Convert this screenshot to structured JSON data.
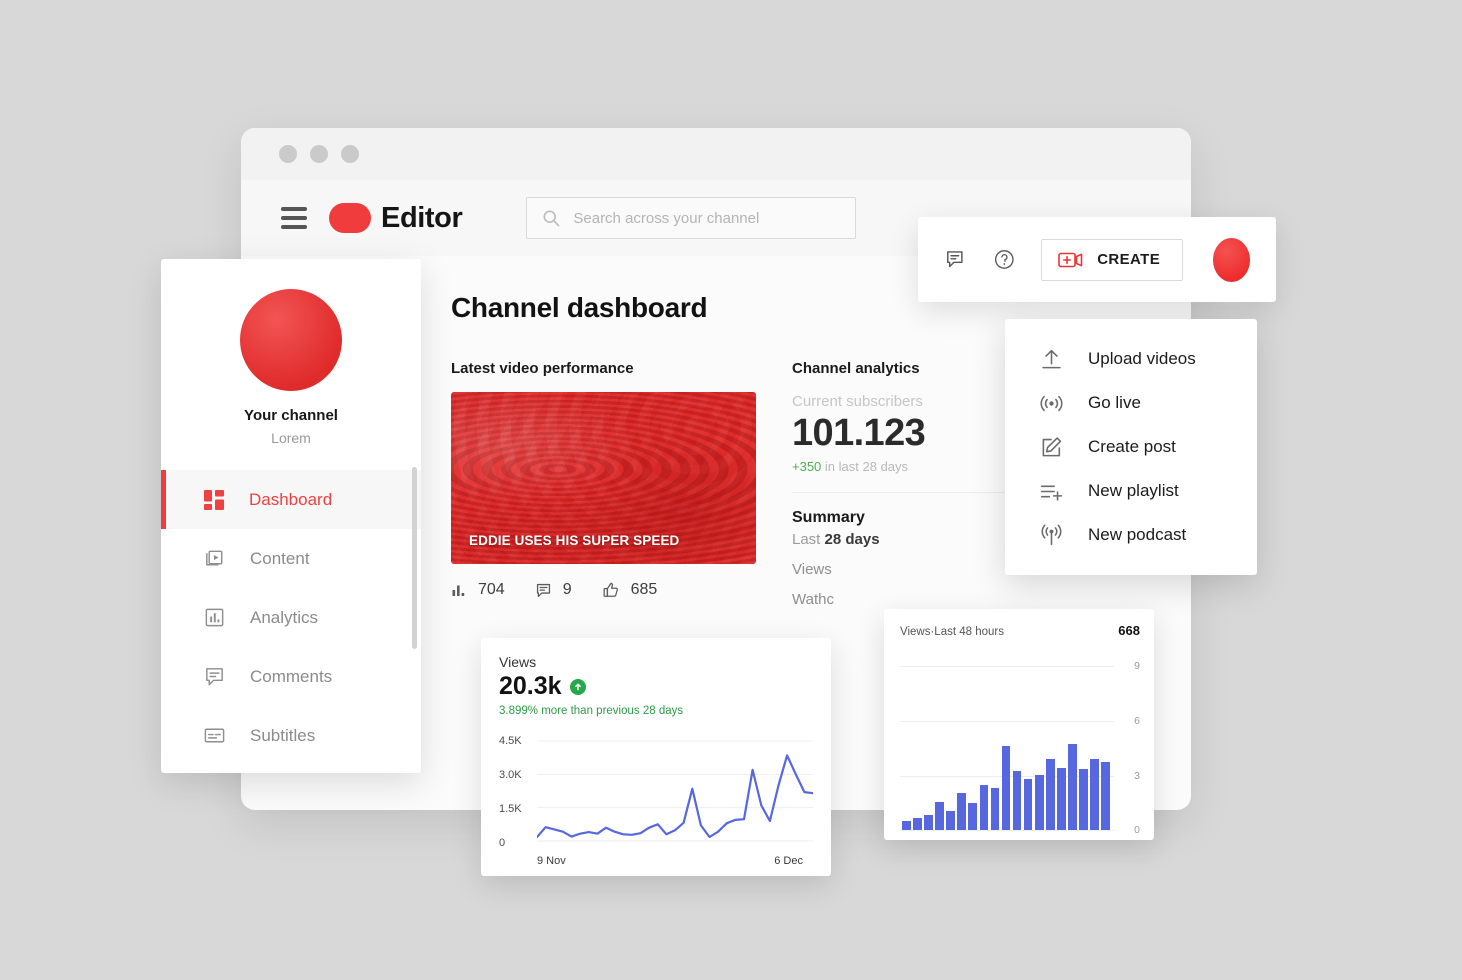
{
  "window": {
    "dots": [
      "close",
      "minimize",
      "maximize"
    ]
  },
  "topbar": {
    "menu_icon": "hamburger-icon",
    "brand": "Editor",
    "search": {
      "icon": "search-icon",
      "placeholder": "Search across your channel",
      "value": ""
    }
  },
  "toolbar": {
    "comment_icon": "comment-icon",
    "help_icon": "help-circle-icon",
    "create_label": "CREATE",
    "create_icon": "video-plus-icon",
    "avatar": "user-avatar"
  },
  "create_menu": {
    "items": [
      {
        "label": "Upload videos",
        "icon": "upload-icon"
      },
      {
        "label": "Go live",
        "icon": "broadcast-icon"
      },
      {
        "label": "Create post",
        "icon": "pencil-square-icon"
      },
      {
        "label": "New playlist",
        "icon": "playlist-add-icon"
      },
      {
        "label": "New podcast",
        "icon": "podcast-icon"
      }
    ]
  },
  "sidebar": {
    "channel_name": "Your channel",
    "channel_handle": "Lorem",
    "items": [
      {
        "label": "Dashboard",
        "icon": "grid-icon",
        "active": true
      },
      {
        "label": "Content",
        "icon": "video-stack-icon",
        "active": false
      },
      {
        "label": "Analytics",
        "icon": "bar-chart-icon",
        "active": false
      },
      {
        "label": "Comments",
        "icon": "comment-icon",
        "active": false
      },
      {
        "label": "Subtitles",
        "icon": "subtitles-icon",
        "active": false
      }
    ]
  },
  "main": {
    "page_title": "Channel dashboard",
    "latest_video": {
      "card_label": "Latest video performance",
      "thumb_title": "EDDIE USES HIS SUPER SPEED",
      "stats": [
        {
          "icon": "bar-chart-icon",
          "value": "704"
        },
        {
          "icon": "comment-icon",
          "value": "9"
        },
        {
          "icon": "thumbs-up-icon",
          "value": "685"
        }
      ]
    },
    "analytics": {
      "card_label": "Channel analytics",
      "subscribers_label": "Current subscribers",
      "subscribers_value": "101.123",
      "delta_value": "+350",
      "delta_suffix": "in last 28 days",
      "summary_title": "Summary",
      "summary_period_prefix": "Last ",
      "summary_period": "28 days",
      "rows": [
        "Views",
        "Wathc"
      ]
    }
  },
  "views_card": {
    "title": "Views",
    "value": "20.3k",
    "trend_icon": "arrow-up-icon",
    "comparison": "3.899% more than previous 28 days"
  },
  "bars_card": {
    "title": "Views·Last 48 hours",
    "value": "668"
  },
  "colors": {
    "brand_red": "#ef3c3c",
    "accent_blue": "#5667e0",
    "positive_green": "#2e9c47",
    "page_bg": "#d8d8d8"
  },
  "chart_data": [
    {
      "type": "line",
      "title": "Views",
      "xlabel": "",
      "ylabel": "",
      "ylim": [
        0,
        4500
      ],
      "yticks": [
        0,
        1500,
        3000,
        4500
      ],
      "ytick_labels": [
        "0",
        "1.5K",
        "3.0K",
        "4.5K"
      ],
      "xtick_labels": [
        "9 Nov",
        "6 Dec"
      ],
      "grid": true,
      "legend": "none",
      "series": [
        {
          "name": "Views",
          "color": "#5667e0",
          "x": [
            "9 Nov",
            "10 Nov",
            "11 Nov",
            "12 Nov",
            "13 Nov",
            "14 Nov",
            "15 Nov",
            "16 Nov",
            "17 Nov",
            "18 Nov",
            "19 Nov",
            "20 Nov",
            "21 Nov",
            "22 Nov",
            "23 Nov",
            "24 Nov",
            "25 Nov",
            "26 Nov",
            "27 Nov",
            "28 Nov",
            "29 Nov",
            "30 Nov",
            "1 Dec",
            "2 Dec",
            "3 Dec",
            "4 Dec",
            "5 Dec",
            "6 Dec"
          ],
          "values": [
            180,
            620,
            520,
            420,
            200,
            330,
            400,
            330,
            600,
            420,
            300,
            280,
            350,
            600,
            750,
            300,
            480,
            820,
            2350,
            700,
            180,
            420,
            800,
            950,
            980,
            3200,
            1600,
            900,
            2500,
            3850,
            3000,
            2200,
            2150
          ]
        }
      ]
    },
    {
      "type": "bar",
      "title": "Views·Last 48 hours",
      "total": 668,
      "xlabel": "",
      "ylabel": "",
      "ylim": [
        0,
        10
      ],
      "yticks": [
        0,
        3,
        6,
        9
      ],
      "ytick_labels": [
        "0",
        "3",
        "6",
        "9"
      ],
      "grid": true,
      "legend": "none",
      "categories": [
        "h1",
        "h2",
        "h3",
        "h4",
        "h5",
        "h6",
        "h7",
        "h8",
        "h9",
        "h10",
        "h11",
        "h12",
        "h13",
        "h14",
        "h15",
        "h16",
        "h17"
      ],
      "values": [
        0.5,
        0.65,
        0.8,
        1.55,
        1.05,
        2.05,
        1.5,
        2.45,
        2.3,
        4.6,
        3.25,
        2.8,
        3.05,
        3.9,
        3.4,
        4.7,
        3.35,
        3.9,
        3.75
      ],
      "color": "#5667e0"
    }
  ]
}
